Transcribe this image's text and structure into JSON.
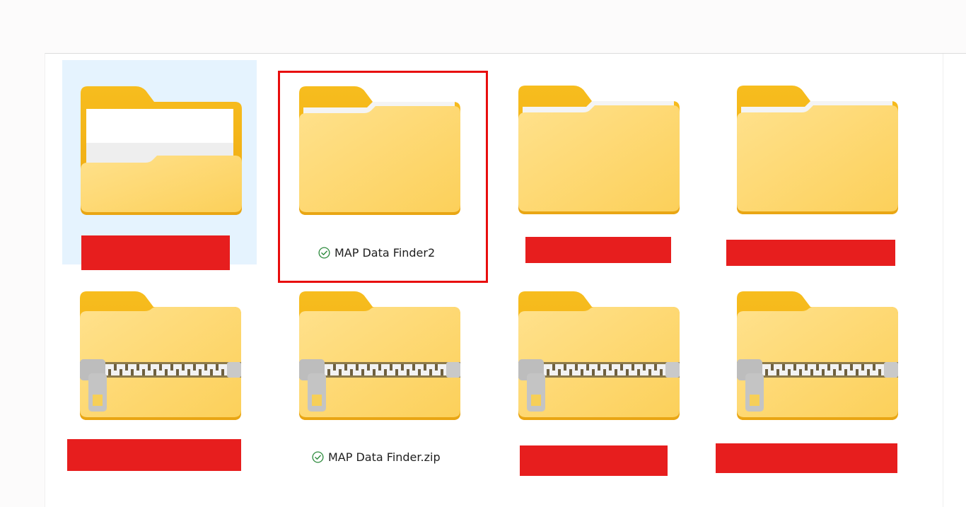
{
  "colors": {
    "folder_back": "#f6b817",
    "folder_front": "#fdd974",
    "selection": "#e5f3fe",
    "highlight_border": "#e80d0d",
    "redaction": "#e71e1e",
    "sync_check": "#2e8b3e"
  },
  "items": [
    {
      "type": "folder",
      "label": "",
      "state": "selected",
      "thumbnail": "preview-icon"
    },
    {
      "type": "folder",
      "label": "MAP Data Finder2",
      "status_icon": "sync-check-icon"
    },
    {
      "type": "folder",
      "label": ""
    },
    {
      "type": "folder",
      "label": ""
    },
    {
      "type": "zip",
      "label": ""
    },
    {
      "type": "zip",
      "label": "MAP Data Finder.zip",
      "status_icon": "sync-check-icon"
    },
    {
      "type": "zip",
      "label": ""
    },
    {
      "type": "zip",
      "label": ""
    }
  ]
}
